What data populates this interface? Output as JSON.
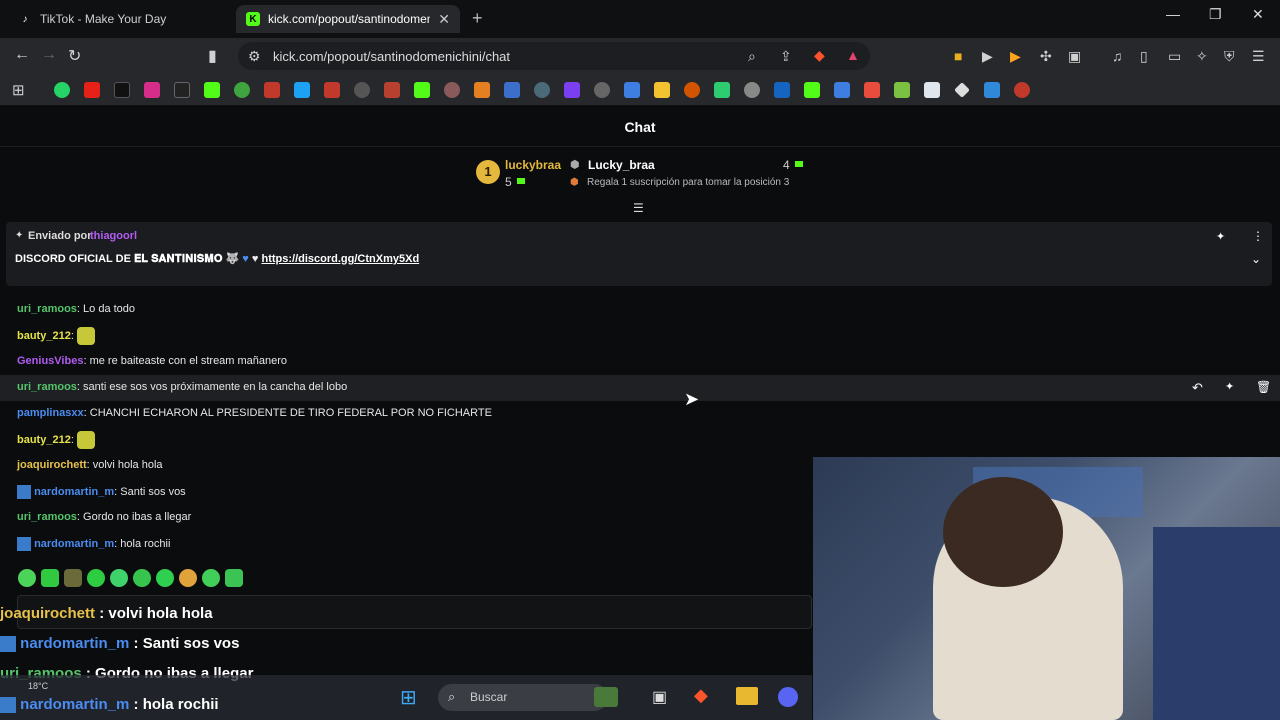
{
  "browser": {
    "tabs": [
      {
        "title": "TikTok - Make Your Day",
        "active": false
      },
      {
        "title": "kick.com/popout/santinodomenichini/chat",
        "active": true
      }
    ],
    "url": "kick.com/popout/santinodomenichini/chat"
  },
  "chat": {
    "title": "Chat",
    "leaderboard": {
      "rank": "1",
      "first_user": "luckybraa",
      "first_count": "5",
      "second_user": "Lucky_braa",
      "second_count": "4",
      "note": "Regala 1 suscripción para tomar la posición 3"
    },
    "pinned": {
      "sent_by_label": "Enviado por",
      "sender": "thiagoorl",
      "text_prefix": "DISCORD OFICIAL DE",
      "text_bold": "𝐄𝐋 𝐒𝐀𝐍𝐓𝐈𝐍𝐈𝐒𝐌𝐎",
      "link": "https://discord.gg/CtnXmy5Xd"
    },
    "messages": [
      {
        "user": "uri_ramoos",
        "color": "#56c46b",
        "text": "Lo da todo"
      },
      {
        "user": "bauty_212",
        "color": "#e6e24b",
        "text": ""
      },
      {
        "user": "GeniusVibes",
        "color": "#b15cf2",
        "text": "me re baiteaste con el stream mañanero"
      },
      {
        "user": "uri_ramoos",
        "color": "#56c46b",
        "text": "santi ese sos vos próximamente en la cancha del lobo"
      },
      {
        "user": "pamplinasxx",
        "color": "#4a8cf0",
        "text": "CHANCHI ECHARON AL PRESIDENTE DE TIRO FEDERAL POR NO FICHARTE"
      },
      {
        "user": "bauty_212",
        "color": "#e6e24b",
        "text": ""
      },
      {
        "user": "joaquirochett",
        "color": "#e6c24b",
        "text": "volvi hola hola"
      },
      {
        "user": "nardomartin_m",
        "color": "#4a8cf0",
        "text": "Santi sos vos"
      },
      {
        "user": "uri_ramoos",
        "color": "#56c46b",
        "text": "Gordo no ibas a llegar"
      },
      {
        "user": "nardomartin_m",
        "color": "#4a8cf0",
        "text": "hola rochii"
      }
    ]
  },
  "overlay": [
    {
      "user": "joaquirochett",
      "color": "#e6c24b",
      "text": "volvi hola hola"
    },
    {
      "user": "nardomartin_m",
      "color": "#4a8cf0",
      "text": "Santi sos vos"
    },
    {
      "user": "uri_ramoos",
      "color": "#56c46b",
      "text": "Gordo no ibas a llegar"
    },
    {
      "user": "nardomartin_m",
      "color": "#4a8cf0",
      "text": "hola rochii"
    }
  ],
  "taskbar": {
    "search": "Buscar",
    "temp": "18°C"
  },
  "colors": {
    "kick_green": "#53fc18",
    "bg": "#0b0c0e",
    "panel": "#1b1c1f"
  }
}
